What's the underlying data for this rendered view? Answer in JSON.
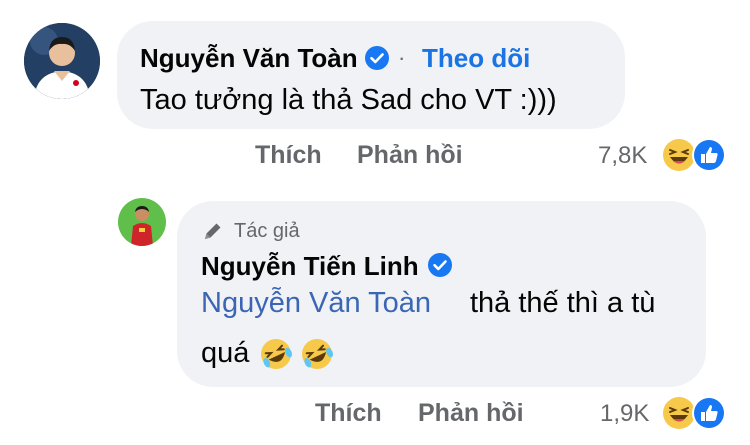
{
  "comment1": {
    "author": "Nguyễn Văn Toàn",
    "follow_label": "Theo dõi",
    "separator": "·",
    "text": "Tao tưởng là thả Sad cho VT :)))",
    "like_label": "Thích",
    "reply_label": "Phản hồi",
    "reaction_count": "7,8K"
  },
  "reply1": {
    "author_badge": "Tác giả",
    "author": "Nguyễn Tiến Linh",
    "mention": "Nguyễn Văn Toàn",
    "text_line1": "thả thế thì a tù",
    "text_line2": "quá",
    "like_label": "Thích",
    "reply_label": "Phản hồi",
    "reaction_count": "1,9K"
  },
  "colors": {
    "bubble": "#f0f2f5",
    "link_blue": "#1b74e4",
    "mention_blue": "#3b66b5",
    "verified_blue": "#1877f2",
    "muted": "#65676b"
  },
  "icons": [
    "verified-badge-icon",
    "haha-reaction-icon",
    "like-reaction-icon",
    "pen-icon",
    "rofl-emoji-icon"
  ]
}
